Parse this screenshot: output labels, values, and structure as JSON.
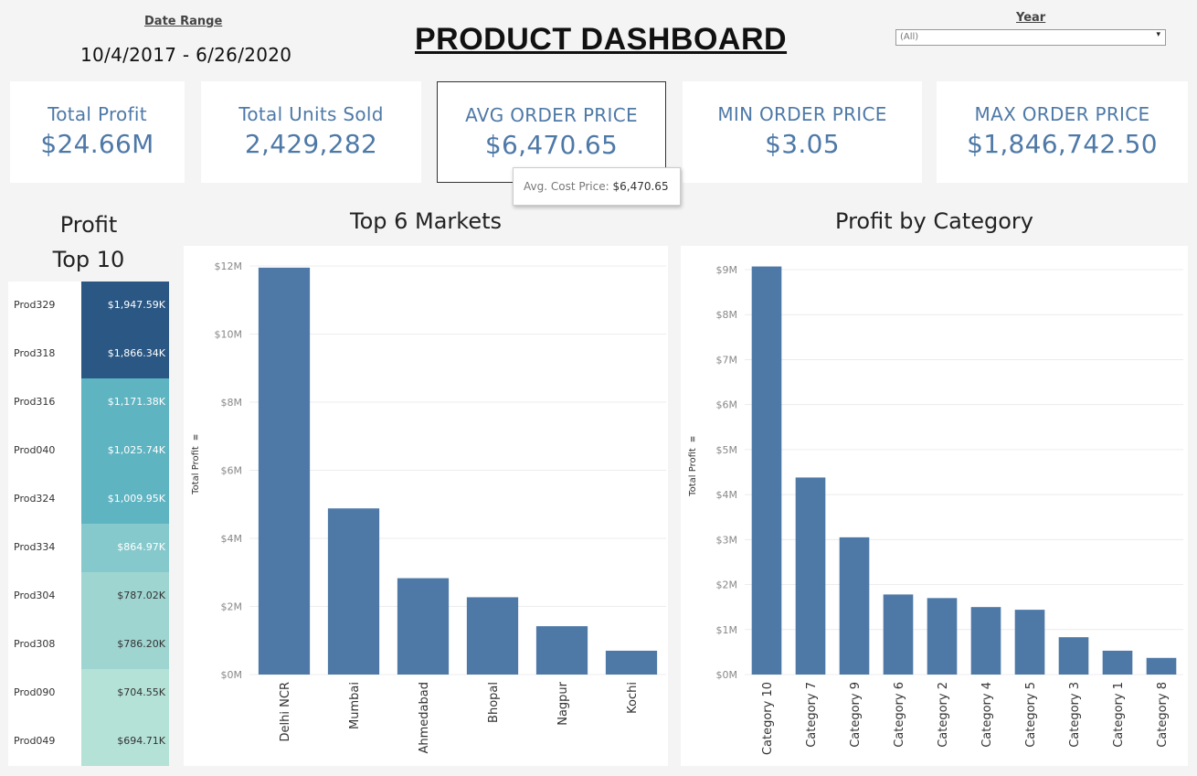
{
  "header": {
    "date_range_label": "Date Range",
    "date_range_value": "10/4/2017 - 6/26/2020",
    "title": "PRODUCT DASHBOARD",
    "year_label": "Year",
    "year_selected": "(All)"
  },
  "kpis": [
    {
      "label": "Total Profit",
      "value": "$24.66M"
    },
    {
      "label": "Total Units Sold",
      "value": "2,429,282"
    },
    {
      "label": "AVG ORDER PRICE",
      "value": "$6,470.65"
    },
    {
      "label": "MIN ORDER PRICE",
      "value": "$3.05"
    },
    {
      "label": "MAX ORDER PRICE",
      "value": "$1,846,742.50"
    }
  ],
  "tooltip": {
    "label": "Avg. Cost Price:",
    "value": "$6,470.65"
  },
  "colors": {
    "accent": "#4e79a7",
    "heat_dark": "#2a5783",
    "heat_mid": "#5fb4c2",
    "heat_light": "#a9dcd3"
  },
  "chart_data": [
    {
      "type": "table",
      "title": "Profit Top 10",
      "title_line1": "Profit",
      "title_line2": "Top 10",
      "rows": [
        {
          "product": "Prod329",
          "value": 1947.59,
          "label": "$1,947.59K"
        },
        {
          "product": "Prod318",
          "value": 1866.34,
          "label": "$1,866.34K"
        },
        {
          "product": "Prod316",
          "value": 1171.38,
          "label": "$1,171.38K"
        },
        {
          "product": "Prod040",
          "value": 1025.74,
          "label": "$1,025.74K"
        },
        {
          "product": "Prod324",
          "value": 1009.95,
          "label": "$1,009.95K"
        },
        {
          "product": "Prod334",
          "value": 864.97,
          "label": "$864.97K"
        },
        {
          "product": "Prod304",
          "value": 787.02,
          "label": "$787.02K"
        },
        {
          "product": "Prod308",
          "value": 786.2,
          "label": "$786.20K"
        },
        {
          "product": "Prod090",
          "value": 704.55,
          "label": "$704.55K"
        },
        {
          "product": "Prod049",
          "value": 694.71,
          "label": "$694.71K"
        }
      ]
    },
    {
      "type": "bar",
      "title": "Top 6 Markets",
      "ylabel": "Total Profit",
      "categories": [
        "Delhi NCR",
        "Mumbai",
        "Ahmedabad",
        "Bhopal",
        "Nagpur",
        "Kochi"
      ],
      "values": [
        11.95,
        4.88,
        2.83,
        2.27,
        1.42,
        0.7
      ],
      "ylim": [
        0,
        12
      ],
      "yticks": [
        0,
        2,
        4,
        6,
        8,
        10,
        12
      ],
      "ytick_labels": [
        "$0M",
        "$2M",
        "$4M",
        "$6M",
        "$8M",
        "$10M",
        "$12M"
      ],
      "grid": true
    },
    {
      "type": "bar",
      "title": "Profit by Category",
      "ylabel": "Total Profit",
      "categories": [
        "Category 10",
        "Category 7",
        "Category 9",
        "Category 6",
        "Category 2",
        "Category 4",
        "Category 5",
        "Category 3",
        "Category 1",
        "Category 8"
      ],
      "values": [
        9.07,
        4.38,
        3.05,
        1.78,
        1.7,
        1.5,
        1.44,
        0.83,
        0.53,
        0.37
      ],
      "ylim": [
        0,
        9
      ],
      "yticks": [
        0,
        1,
        2,
        3,
        4,
        5,
        6,
        7,
        8,
        9
      ],
      "ytick_labels": [
        "$0M",
        "$1M",
        "$2M",
        "$3M",
        "$4M",
        "$5M",
        "$6M",
        "$7M",
        "$8M",
        "$9M"
      ],
      "grid": true
    }
  ]
}
